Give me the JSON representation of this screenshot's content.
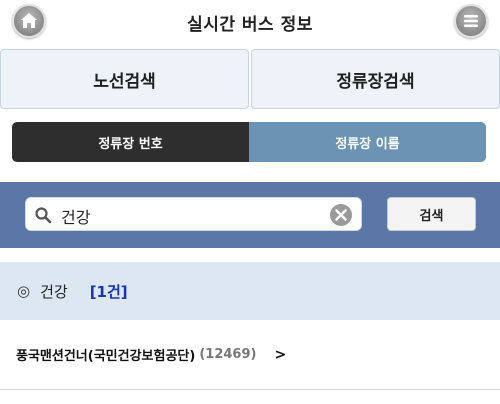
{
  "header": {
    "title": "실시간 버스 정보",
    "home_icon": "home-icon",
    "menu_icon": "menu-icon"
  },
  "main_tabs": [
    {
      "label": "노선검색"
    },
    {
      "label": "정류장검색"
    }
  ],
  "segment": [
    {
      "label": "정류장 번호",
      "active": true
    },
    {
      "label": "정류장 이름",
      "active": false
    }
  ],
  "search": {
    "value": "건강",
    "button_label": "검색"
  },
  "result": {
    "mark": "◎",
    "keyword": "건강",
    "count": "[1건]"
  },
  "list": [
    {
      "name": "풍국맨션건너(국민건강보험공단)",
      "id": "(12469)",
      "chevron": ">"
    }
  ],
  "colors": {
    "band": "#5b77a8",
    "seg_active": "#2e2e2e",
    "seg_inactive": "#6a93b4",
    "result_bar": "#dce7f2",
    "count": "#1a33b0"
  }
}
